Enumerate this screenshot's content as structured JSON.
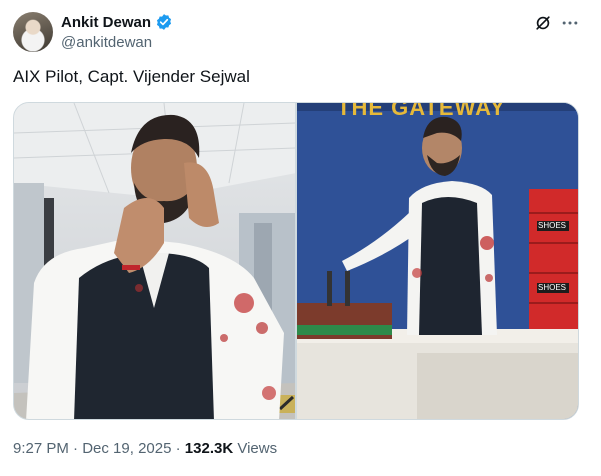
{
  "author": {
    "display_name": "Ankit Dewan",
    "handle": "@ankitdewan",
    "verified_color": "#1d9bf0"
  },
  "tweet": {
    "text": "AIX Pilot, Capt. Vijender Sejwal"
  },
  "media": {
    "right_photo_sign": "THE GATEWAY",
    "crate_labels": [
      "SHOES",
      "SHOES"
    ]
  },
  "meta": {
    "time": "9:27 PM",
    "separator": "·",
    "date": "Dec 19, 2025",
    "views_count": "132.3K",
    "views_label": "Views"
  },
  "icons": [
    "verified-badge-icon",
    "grok-icon",
    "more-icon"
  ]
}
